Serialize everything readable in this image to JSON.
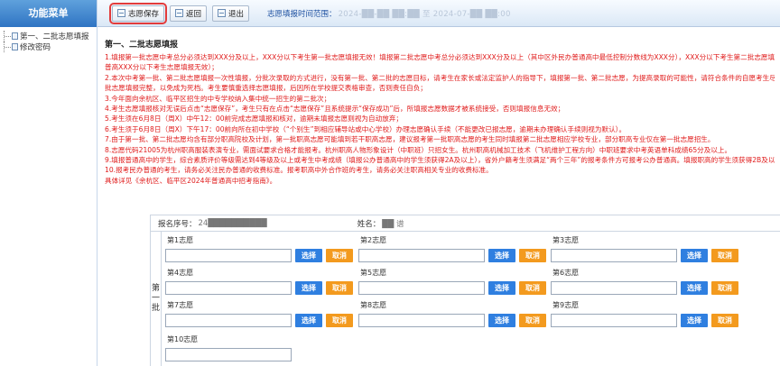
{
  "sidebar": {
    "title": "功能菜单",
    "items": [
      {
        "label": "第一、二批志愿填报"
      },
      {
        "label": "修改密码"
      }
    ]
  },
  "toolbar": {
    "save_label": "志愿保存",
    "back_label": "返回",
    "exit_label": "退出",
    "time_label": "志愿填报时间范围：",
    "time_value": "2024-██-██ ██:██ 至 2024-07-██ ██:00"
  },
  "notes": {
    "title": "第一、二批志愿填报",
    "lines": [
      "1.填报第一批志愿中考总分必须达到XXX分及以上，XXX分以下考生第一批志愿填报无效！填报第二批志愿中考总分必须达到XXX分及以上（其中区外民办普通高中最低控制分数线为XXX分），XXX分以下考生第二批志愿填报无效（其中区外民办",
      "普高XXX分以下考生志愿填报无效）；",
      "2.本次中考第一批、第二批志愿填报一次性填报，分批次录取的方式进行，没有第一批、第二批的志愿目标，请考生在家长或法定监护人的指导下，填报第一批、第二批志愿，为提高录取的可能性，请符合条件的自愿考生尽可能将第一",
      "批志愿填报完整，以免成为死档。考生要慎重选择志愿填报，后因所在学校提交表格审查，否则责任自负；",
      "3.今年面向余杭区、临平区招生的中专学校纳入集中统一招生的第二批次；",
      "4.考生志愿填报核对无误后点击“志愿保存”，考生只有在点击“志愿保存”且系统提示“保存成功”后，所填报志愿数据才被系统接受，否则填报信息无效；",
      "5.考生须在6月8日（周X）中午12：00前完成志愿填报和核对，逾期未填报志愿则视为自动放弃；",
      "6.考生须于6月8日（周X）下午17：00前向所在初中学校（“个别生”到相应辅导站或中心学校）办理志愿确认手续（不能更改已报志愿，逾期未办理确认手续则视为默认）。",
      "7.由于第一批、第二批志愿均含有部分职高院校及计划，第一批职高志愿可能填到若干职高志愿，建议报考第一批职高志愿的考生同时填报第二批志愿相应学校专业，部分职高专业仅在第一批志愿招生。",
      "8.志愿代码21005为杭州职高服装表演专业，需面试要求合格才能报考。杭州职高人物形象设计（中职班）只招女生。杭州职高机械加工技术（飞机维护工程方向）中职班要求中考英语单科成绩65分及以上。",
      "9.填报普通高中的学生，综合素质评价等级需达到4等级及以上或考生中考成绩（填报公办普通高中的学生须获得2A及以上），省外户籍考生须满足“两个三年”的报考条件方可报考公办普通高。填报职高的学生须获得2B及以上；",
      "10.报考民办普通的考生，请务必关注民办普通的收费标准。报考职高中外合作班的考生，请务必关注职高相关专业的收费标准。",
      "具体详见《余杭区、临平区2024年普通高中招考指南》。"
    ]
  },
  "form": {
    "reg_label": "报名序号：",
    "reg_value": "24██████████",
    "name_label": "姓名：",
    "name_value": "██ 谱",
    "batch_label": "第一批",
    "select_label": "选择",
    "cancel_label": "取消",
    "prefs": [
      {
        "label": "第1志愿"
      },
      {
        "label": "第2志愿"
      },
      {
        "label": "第3志愿"
      },
      {
        "label": "第4志愿"
      },
      {
        "label": "第5志愿"
      },
      {
        "label": "第6志愿"
      },
      {
        "label": "第7志愿"
      },
      {
        "label": "第8志愿"
      },
      {
        "label": "第9志愿"
      },
      {
        "label": "第10志愿"
      }
    ]
  },
  "colors": {
    "sidebar_header": "#2f74c3",
    "notice_red": "#e01b1b",
    "select_blue": "#2f7fe0",
    "cancel_orange": "#f39a1e",
    "highlight_red": "#e23b3b"
  }
}
